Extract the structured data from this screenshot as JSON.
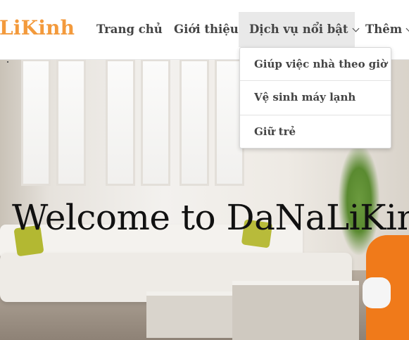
{
  "brand": "LiKinh",
  "nav": {
    "home": "Trang chủ",
    "about": "Giới thiệu",
    "services": "Dịch vụ nổi bật",
    "more": "Thêm"
  },
  "dropdown": {
    "items": [
      "Giúp việc nhà theo giờ",
      "Vệ sinh máy lạnh",
      "Giữ trẻ"
    ]
  },
  "hero": {
    "title": "Welcome to DaNaLiKinh"
  },
  "colors": {
    "brand": "#f39a3c",
    "nav_text": "#444444",
    "active_bg": "#e9e9e9"
  }
}
